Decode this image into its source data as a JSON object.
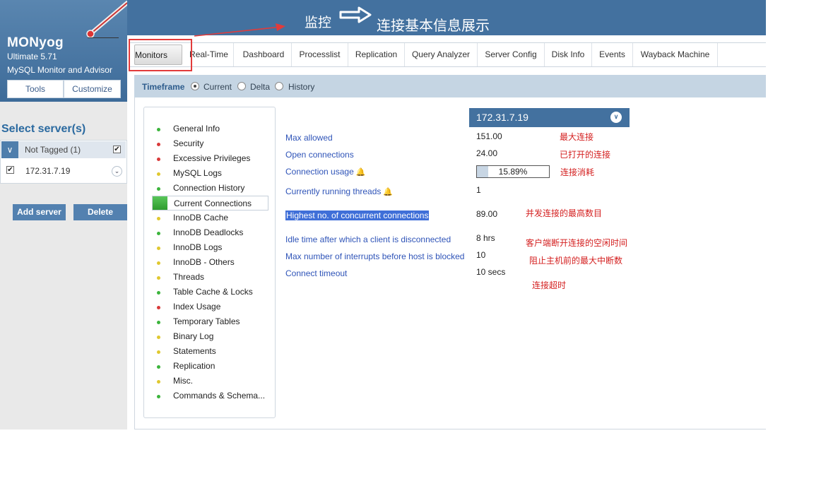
{
  "brand": {
    "name": "MONyog",
    "edition": "Ultimate 5.71",
    "tagline": "MySQL Monitor and Advisor",
    "tools_label": "Tools",
    "customize_label": "Customize"
  },
  "annotation": {
    "title": "监控",
    "subtitle": "连接基本信息展示"
  },
  "sidebar": {
    "select_title": "Select server(s)",
    "tag_label": "Not Tagged (1)",
    "server_label": "172.31.7.19",
    "add_label": "Add server",
    "delete_label": "Delete"
  },
  "tabs": [
    "Monitors",
    "Real-Time",
    "Dashboard",
    "Processlist",
    "Replication",
    "Query Analyzer",
    "Server Config",
    "Disk Info",
    "Events",
    "Wayback Machine"
  ],
  "timeframe": {
    "label": "Timeframe",
    "options": [
      "Current",
      "Delta",
      "History"
    ],
    "selected": "Current"
  },
  "menu": [
    {
      "label": "General Info",
      "status": "#3cb43c"
    },
    {
      "label": "Security",
      "status": "#d93a3a"
    },
    {
      "label": "Excessive Privileges",
      "status": "#d93a3a"
    },
    {
      "label": "MySQL Logs",
      "status": "#e0c830"
    },
    {
      "label": "Connection History",
      "status": "#3cb43c"
    },
    {
      "label": "Current Connections",
      "status": "#3cb43c"
    },
    {
      "label": "InnoDB Cache",
      "status": "#e0c830"
    },
    {
      "label": "InnoDB Deadlocks",
      "status": "#3cb43c"
    },
    {
      "label": "InnoDB Logs",
      "status": "#e0c830"
    },
    {
      "label": "InnoDB - Others",
      "status": "#e0c830"
    },
    {
      "label": "Threads",
      "status": "#e0c830"
    },
    {
      "label": "Table Cache & Locks",
      "status": "#3cb43c"
    },
    {
      "label": "Index Usage",
      "status": "#d93a3a"
    },
    {
      "label": "Temporary Tables",
      "status": "#3cb43c"
    },
    {
      "label": "Binary Log",
      "status": "#e0c830"
    },
    {
      "label": "Statements",
      "status": "#e0c830"
    },
    {
      "label": "Replication",
      "status": "#3cb43c"
    },
    {
      "label": "Misc.",
      "status": "#e0c830"
    },
    {
      "label": "Commands & Schema...",
      "status": "#3cb43c"
    }
  ],
  "server_header": "172.31.7.19",
  "metrics": {
    "max_allowed": {
      "label": "Max allowed",
      "value": "151.00",
      "note": "最大连接"
    },
    "open_connections": {
      "label": "Open connections",
      "value": "24.00",
      "note": "已打开的连接"
    },
    "connection_usage": {
      "label": "Connection usage",
      "value": "15.89%",
      "note": "连接消耗",
      "fraction": 0.1589
    },
    "running_threads": {
      "label": "Currently running threads",
      "value": "1"
    },
    "highest_concurrent": {
      "label": "Highest no. of concurrent connections",
      "value": "89.00",
      "note": "并发连接的最高数目"
    },
    "idle_time": {
      "label": "Idle time after which a client is disconnected",
      "value": "8 hrs",
      "note": "客户端断开连接的空闲时间"
    },
    "max_interrupts": {
      "label": "Max number of interrupts before host is blocked",
      "value": "10",
      "note": "阻止主机前的最大中断数"
    },
    "connect_timeout": {
      "label": "Connect timeout",
      "value": "10 secs",
      "note": "连接超时"
    }
  },
  "colors": {
    "header": "#43719f",
    "accent_red": "#e23b3b",
    "link": "#2f54b8"
  }
}
